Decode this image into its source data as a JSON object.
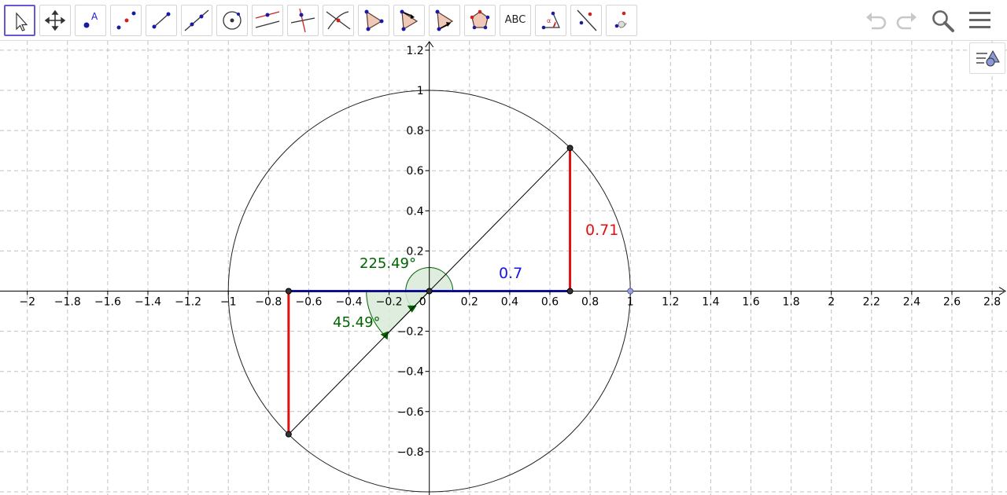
{
  "toolbar": {
    "tools": [
      {
        "name": "move-tool",
        "icon": "cursor-arrow-icon",
        "selected": true
      },
      {
        "name": "move-graphics-view-tool",
        "icon": "four-arrows-icon"
      },
      {
        "name": "point-tool",
        "icon": "point-with-label-icon"
      },
      {
        "name": "two-points-tool",
        "icon": "two-points-icon"
      },
      {
        "name": "segment-tool",
        "icon": "segment-icon"
      },
      {
        "name": "line-tool",
        "icon": "line-icon"
      },
      {
        "name": "circle-center-point-tool",
        "icon": "circle-center-point-icon"
      },
      {
        "name": "parallel-line-tool",
        "icon": "parallel-line-icon"
      },
      {
        "name": "perpendicular-line-tool",
        "icon": "perpendicular-line-icon"
      },
      {
        "name": "intersect-tool",
        "icon": "intersect-icon"
      },
      {
        "name": "polygon-tool",
        "icon": "polygon-icon"
      },
      {
        "name": "vector-polygon-tool",
        "icon": "vector-polygon-icon"
      },
      {
        "name": "rigid-polygon-tool",
        "icon": "rigid-polygon-icon"
      },
      {
        "name": "regular-polygon-tool",
        "icon": "regular-polygon-icon"
      },
      {
        "name": "text-tool",
        "icon": "text-icon",
        "label": "ABC"
      },
      {
        "name": "angle-tool",
        "icon": "angle-icon"
      },
      {
        "name": "reflect-line-tool",
        "icon": "reflect-line-icon"
      },
      {
        "name": "rotate-tool",
        "icon": "rotate-around-point-icon"
      }
    ],
    "right": [
      {
        "name": "undo",
        "icon": "undo-icon"
      },
      {
        "name": "redo",
        "icon": "redo-icon"
      },
      {
        "name": "search",
        "icon": "search-icon"
      },
      {
        "name": "menu",
        "icon": "hamburger-menu-icon"
      }
    ]
  },
  "graphics_view": {
    "x_ticks": [
      "−2",
      "−1.8",
      "−1.6",
      "−1.4",
      "−1.2",
      "−1",
      "−0.8",
      "−0.6",
      "−0.4",
      "−0.2",
      "0",
      "0.2",
      "0.4",
      "0.6",
      "0.8",
      "1",
      "1.2",
      "1.4",
      "1.6",
      "1.8",
      "2",
      "2.2",
      "2.4",
      "2.6",
      "2.8"
    ],
    "y_ticks": [
      "1.2",
      "1",
      "0.8",
      "0.6",
      "0.4",
      "0.2",
      "−0.2",
      "−0.4",
      "−0.6",
      "−0.8"
    ],
    "x_range": [
      -2.12,
      2.87
    ],
    "y_range": [
      -1.0,
      1.22
    ],
    "grid": true,
    "unit_circle": {
      "cx": 0,
      "cy": 0,
      "r": 1
    },
    "points": [
      {
        "name": "point-P",
        "x": 0.7,
        "y": 0.713
      },
      {
        "name": "point-P-prime",
        "x": -0.7,
        "y": -0.713
      },
      {
        "name": "point-P-foot",
        "x": 0.7,
        "y": 0
      },
      {
        "name": "point-P-prime-foot",
        "x": -0.7,
        "y": 0
      },
      {
        "name": "origin-point",
        "x": 0,
        "y": 0
      },
      {
        "name": "unit-point",
        "x": 1,
        "y": 0
      }
    ],
    "labels": {
      "angle_big": "225.49°",
      "angle_small": "45.49°",
      "blue_value": "0.7",
      "red_value": "0.71"
    },
    "angle_big_deg": 225.49,
    "angle_small_deg": 45.49,
    "colors": {
      "grid": "#c0c0c0",
      "axis": "#000000",
      "circle": "#222222",
      "blue": "#1515e6",
      "red": "#e01010",
      "green": "#006400",
      "sector_fill": "#d9ead9",
      "point": "#333333",
      "unit_point": "#9aa0d8"
    }
  }
}
